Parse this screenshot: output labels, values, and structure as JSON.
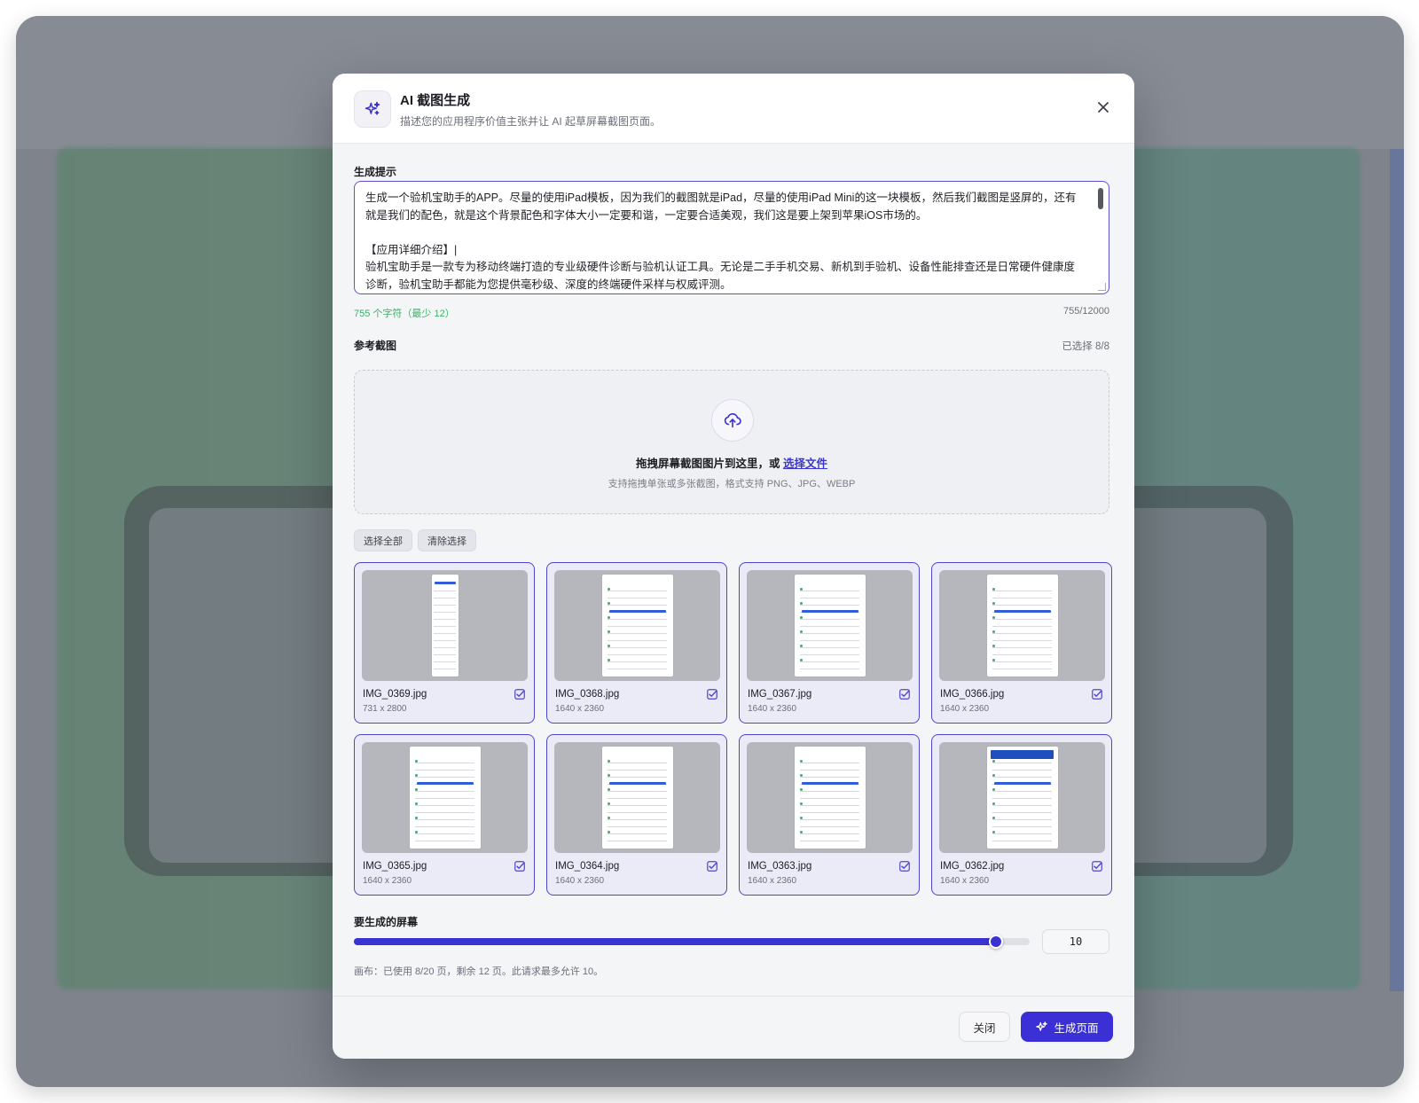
{
  "dialog": {
    "title": "AI 截图生成",
    "subtitle": "描述您的应用程序价值主张并让 AI 起草屏幕截图页面。",
    "icon": "sparkles-icon"
  },
  "prompt": {
    "label": "生成提示",
    "lines": [
      "生成一个验机宝助手的APP。尽量的使用iPad模板，因为我们的截图就是iPad，尽量的使用iPad Mini的这一块模板，然后我们截图是竖屏的，还有",
      "就是我们的配色，就是这个背景配色和字体大小一定要和谐，一定要合适美观，我们这是要上架到苹果iOS市场的。",
      "",
      "【应用详细介绍】|",
      "验机宝助手是一款专为移动终端打造的专业级硬件诊断与验机认证工具。无论是二手手机交易、新机到手验机、设备性能排查还是日常硬件健康度",
      "诊断，验机宝助手都能为您提供毫秒级、深度的终端硬件采样与权威评测。"
    ],
    "char_status": "755 个字符（最少 12）",
    "char_counter": "755/12000"
  },
  "reference": {
    "label": "参考截图",
    "selected": "已选择 8/8",
    "drop_text": "拖拽屏幕截图图片到这里，或",
    "drop_link": "选择文件",
    "drop_hint": "支持拖拽单张或多张截图，格式支持 PNG、JPG、WEBP",
    "select_all": "选择全部",
    "clear_selection": "清除选择",
    "images": [
      {
        "name": "IMG_0369.jpg",
        "size": "731 x 2800",
        "checked": true
      },
      {
        "name": "IMG_0368.jpg",
        "size": "1640 x 2360",
        "checked": true
      },
      {
        "name": "IMG_0367.jpg",
        "size": "1640 x 2360",
        "checked": true
      },
      {
        "name": "IMG_0366.jpg",
        "size": "1640 x 2360",
        "checked": true
      },
      {
        "name": "IMG_0365.jpg",
        "size": "1640 x 2360",
        "checked": true
      },
      {
        "name": "IMG_0364.jpg",
        "size": "1640 x 2360",
        "checked": true
      },
      {
        "name": "IMG_0363.jpg",
        "size": "1640 x 2360",
        "checked": true
      },
      {
        "name": "IMG_0362.jpg",
        "size": "1640 x 2360",
        "checked": true
      }
    ]
  },
  "screens": {
    "label": "要生成的屏幕",
    "value": "10",
    "slider_fraction": 0.95,
    "note": "画布：已使用 8/20 页，剩余 12 页。此请求最多允许 10。"
  },
  "footer": {
    "close_label": "关闭",
    "generate_label": "生成页面"
  },
  "colors": {
    "accent": "#3b30d6",
    "success": "#3fae6a"
  }
}
